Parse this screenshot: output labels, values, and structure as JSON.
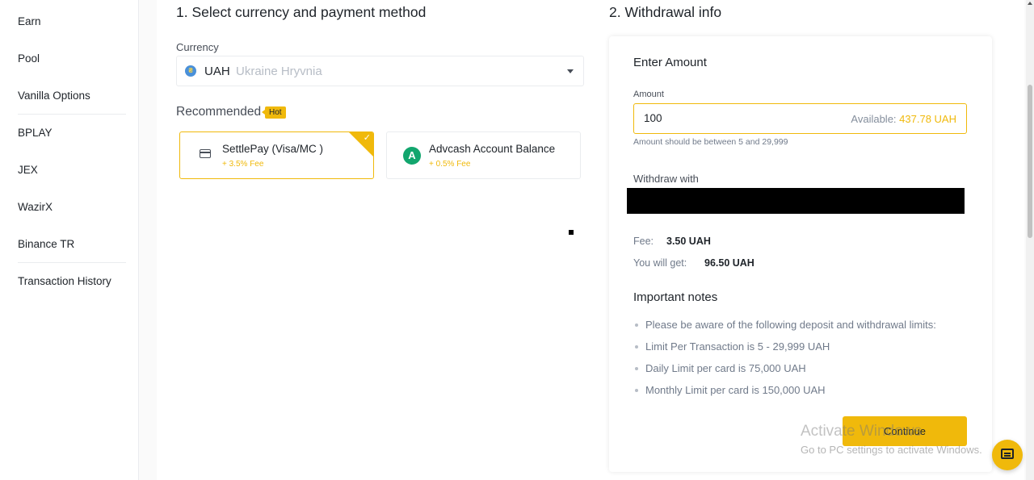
{
  "sidebar": {
    "items": [
      {
        "label": "Earn"
      },
      {
        "label": "Pool"
      },
      {
        "label": "Vanilla Options"
      },
      {
        "label": "BPLAY"
      },
      {
        "label": "JEX"
      },
      {
        "label": "WazirX"
      },
      {
        "label": "Binance TR"
      },
      {
        "label": "Transaction History"
      }
    ]
  },
  "select_section": {
    "title": "1. Select currency and payment method",
    "currency_label": "Currency",
    "currency_code": "UAH",
    "currency_name": "Ukraine Hryvnia",
    "recommended_label": "Recommended",
    "hot_badge": "Hot",
    "methods": [
      {
        "name": "SettlePay (Visa/MC )",
        "fee": "+ 3.5% Fee",
        "selected": true,
        "icon": "card-icon"
      },
      {
        "name": "Advcash Account Balance",
        "fee": "+ 0.5% Fee",
        "selected": false,
        "icon": "advcash-logo-icon"
      }
    ]
  },
  "withdrawal": {
    "title": "2. Withdrawal info",
    "enter_amount_title": "Enter Amount",
    "amount_label": "Amount",
    "amount_value": "100",
    "available_label": "Available:",
    "available_amount": "437.78 UAH",
    "amount_hint": "Amount should be between 5 and 29,999",
    "withdraw_with_label": "Withdraw with",
    "fee_label": "Fee:",
    "fee_value": "3.50 UAH",
    "get_label": "You will get:",
    "get_value": "96.50 UAH",
    "notes_title": "Important notes",
    "notes": [
      "Please be aware of the following deposit and withdrawal limits:",
      "Limit Per Transaction is 5 - 29,999 UAH",
      "Daily Limit per card is 75,000 UAH",
      "Monthly Limit per card is 150,000 UAH"
    ],
    "continue_label": "Continue"
  },
  "watermark": {
    "line1": "Activate Windows",
    "line2": "Go to PC settings to activate Windows."
  },
  "colors": {
    "accent": "#f0b90b",
    "text": "#1e2329",
    "muted": "#707a8a"
  }
}
